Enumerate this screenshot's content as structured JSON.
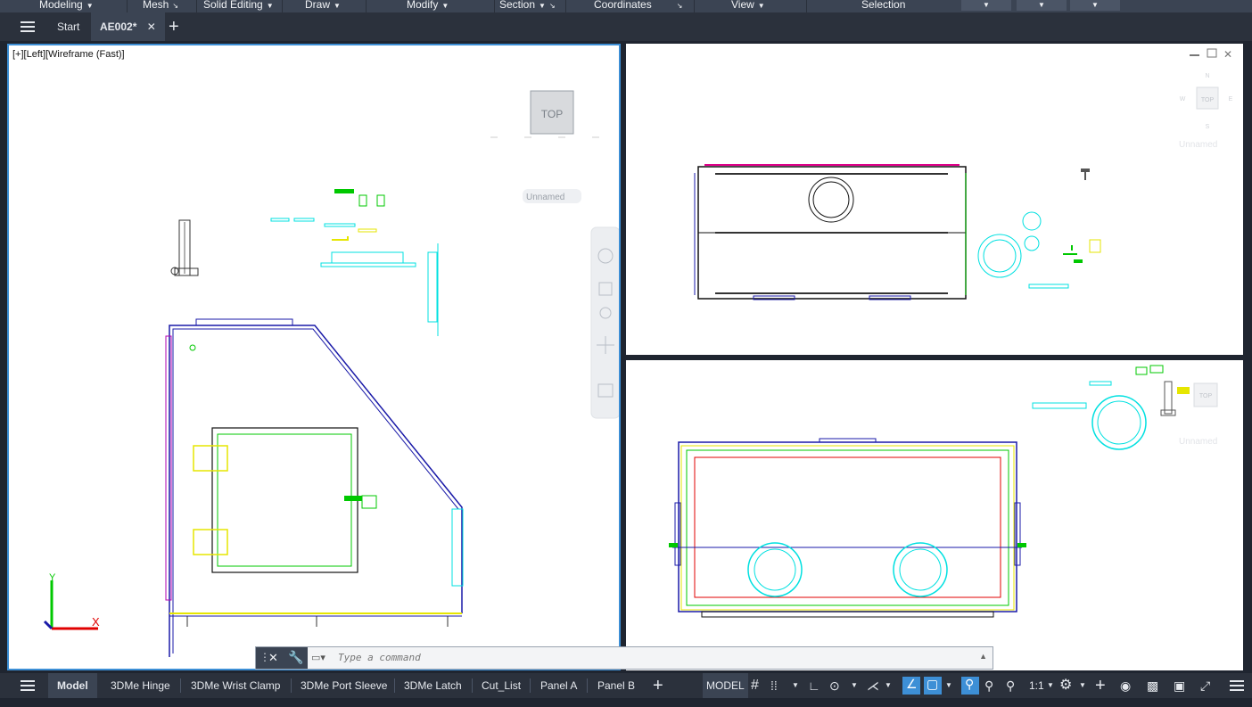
{
  "ribbon": {
    "panels": [
      "Modeling",
      "Mesh",
      "Solid Editing",
      "Draw",
      "Modify",
      "Section",
      "Coordinates",
      "View",
      "Selection"
    ]
  },
  "tabs": {
    "menu_icon": "menu-icon",
    "start": "Start",
    "drawing": "AE002*",
    "new_tab_icon": "plus-icon"
  },
  "viewports": {
    "left": {
      "label": "[+][Left][Wireframe (Fast)]",
      "viewcube": "TOP",
      "ucs_name": "Unnamed",
      "axis_x": "X",
      "axis_y": "Y"
    },
    "top_right": {
      "viewcube": "TOP",
      "ucs_name": "Unnamed",
      "compass": {
        "n": "N",
        "s": "S",
        "w": "W",
        "e": "E"
      }
    },
    "bottom_right": {
      "viewcube": "TOP",
      "ucs_name": "Unnamed"
    }
  },
  "command": {
    "placeholder": "Type a command"
  },
  "layout_tabs": [
    "Model",
    "3DMe Hinge",
    "3DMe Wrist Clamp",
    "3DMe Port Sleeve",
    "3DMe Latch",
    "Cut_List",
    "Panel A",
    "Panel B"
  ],
  "status": {
    "space": "MODEL",
    "scale": "1:1"
  },
  "colors": {
    "accent": "#3d8fd6",
    "cyan": "#00e0e0",
    "green": "#00c800",
    "yellow": "#e6e600",
    "magenta": "#e0008a",
    "blue": "#1a1aa8"
  }
}
